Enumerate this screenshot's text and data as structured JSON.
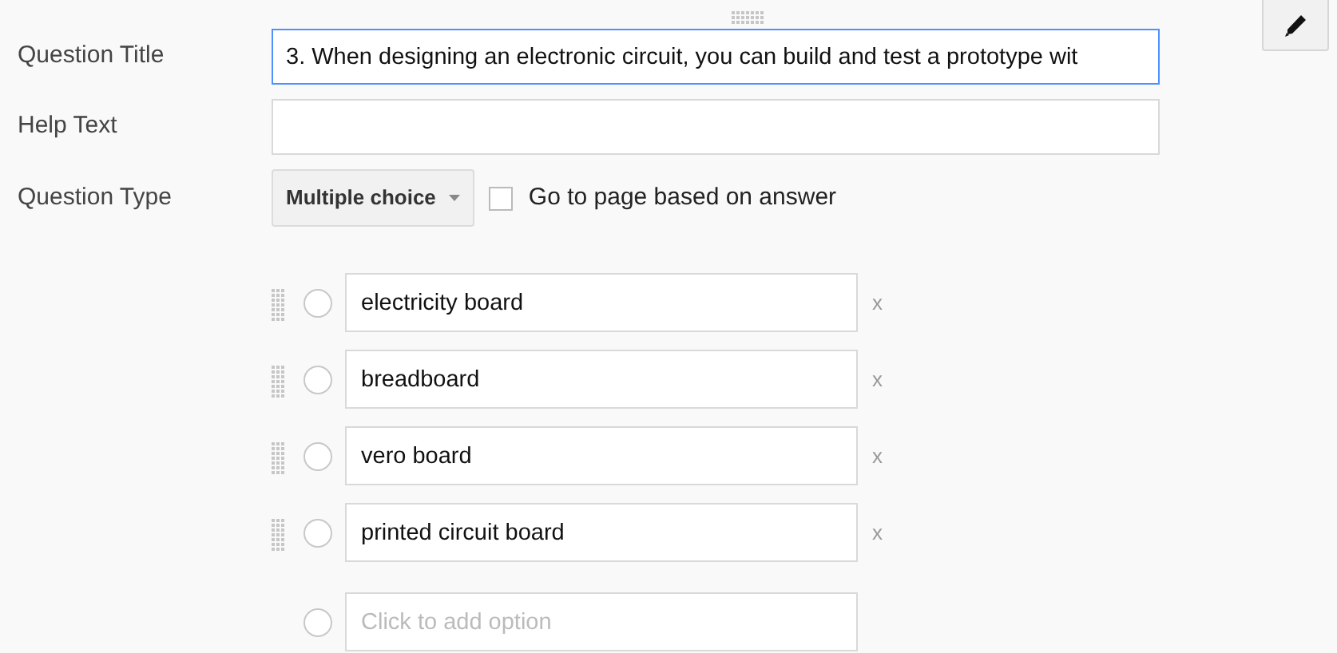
{
  "fields": [
    {
      "label": "Question Title",
      "value": "3. When designing an electronic circuit, you can build and test a prototype wit",
      "focused": true
    },
    {
      "label": "Help Text",
      "focused": false
    }
  ],
  "question_type": {
    "label": "Question Type",
    "dropdown": "Multiple choice",
    "checkbox": {
      "label": "Go to page based on answer",
      "checked": false
    }
  },
  "options": [
    {
      "value": "electricity board",
      "selected": false,
      "remove": "x"
    },
    {
      "value": "breadboard",
      "selected": false,
      "remove": "x"
    },
    {
      "value": "vero board",
      "selected": false,
      "remove": "x"
    },
    {
      "value": "printed circuit board",
      "selected": false,
      "remove": "x"
    }
  ],
  "add_option": {
    "placeholder": "Click to add option",
    "selected": false
  }
}
